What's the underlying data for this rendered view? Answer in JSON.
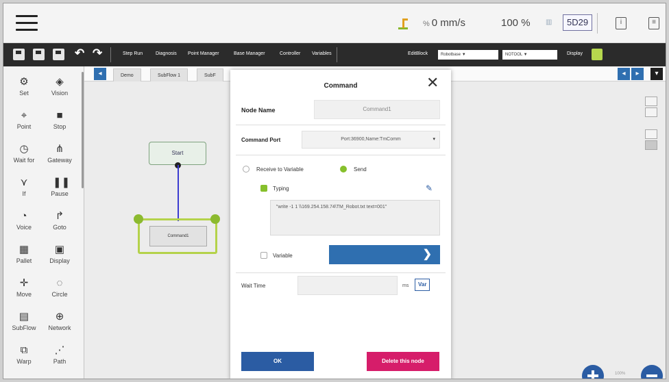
{
  "topbar": {
    "menu_icon": "hamburger-menu-icon",
    "robot_icon": "robot-arm-icon",
    "speed_prefix": "%",
    "speed_value": "0 mm/s",
    "percent": "100 %",
    "code": "5D29"
  },
  "toolbar": {
    "menus": [
      "Step Run",
      "Diagnosis",
      "Point Manager",
      "Base Manager",
      "Controller",
      "Variables"
    ],
    "edit_block": "EditBlock",
    "dropdown1": "Robotbase",
    "dropdown2": "NOTOOL",
    "display": "Display"
  },
  "palette": {
    "items": [
      {
        "label": "Set",
        "icon": "set-icon"
      },
      {
        "label": "Vision",
        "icon": "vision-icon"
      },
      {
        "label": "Point",
        "icon": "point-icon"
      },
      {
        "label": "Stop",
        "icon": "stop-icon"
      },
      {
        "label": "Wait for",
        "icon": "wait-for-icon"
      },
      {
        "label": "Gateway",
        "icon": "gateway-icon"
      },
      {
        "label": "If",
        "icon": "if-icon"
      },
      {
        "label": "Pause",
        "icon": "pause-icon"
      },
      {
        "label": "Voice",
        "icon": "voice-icon"
      },
      {
        "label": "Goto",
        "icon": "goto-icon"
      },
      {
        "label": "Pallet",
        "icon": "pallet-icon"
      },
      {
        "label": "Display",
        "icon": "display-icon"
      },
      {
        "label": "Move",
        "icon": "move-icon"
      },
      {
        "label": "Circle",
        "icon": "circle-icon"
      },
      {
        "label": "SubFlow",
        "icon": "subflow-icon"
      },
      {
        "label": "Network",
        "icon": "network-icon"
      },
      {
        "label": "Warp",
        "icon": "warp-icon"
      },
      {
        "label": "Path",
        "icon": "path-icon"
      }
    ]
  },
  "canvas": {
    "tabs": [
      "Demo",
      "SubFlow 1",
      "SubF"
    ],
    "start_node": "Start",
    "command_node": "Command1",
    "zoom_label": "100%"
  },
  "modal": {
    "title": "Command",
    "node_name_label": "Node Name",
    "node_name_value": "Command1",
    "command_port_label": "Command Port",
    "command_port_value": "Port:36900,Name:TmComm",
    "receive_label": "Receive to Variable",
    "send_label": "Send",
    "typing_label": "Typing",
    "typing_value": "\"write -1 1 \\\\169.254.158.74\\TM_Robot.txt text=001\"",
    "variable_label": "Variable",
    "wait_time_label": "Wait Time",
    "ms_label": "ms",
    "var_button": "Var",
    "ok_button": "OK",
    "delete_button": "Delete this node"
  }
}
